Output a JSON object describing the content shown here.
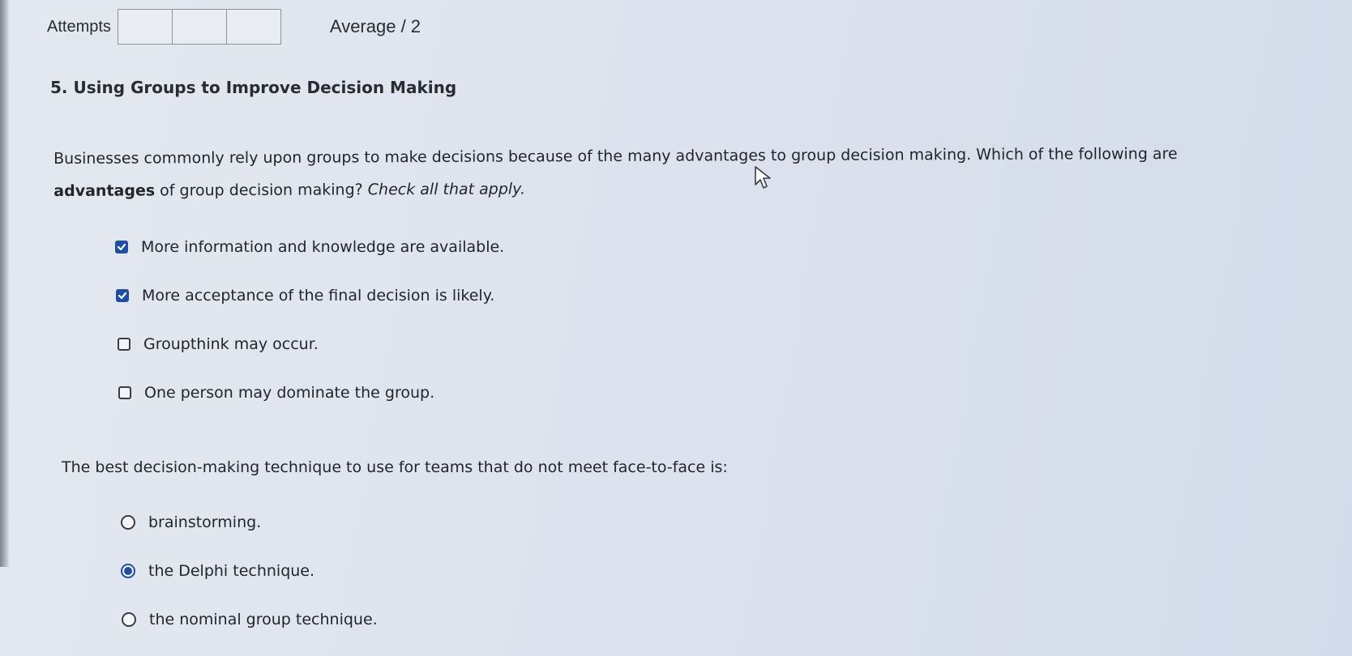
{
  "attempts": {
    "label": "Attempts",
    "boxes": 3,
    "average_label": "Average / 2"
  },
  "question": {
    "title": "5. Using Groups to Improve Decision Making",
    "prompt_part1": "Businesses commonly rely upon groups to make decisions because of the many advantages to group decision making. Which of the following are",
    "prompt_bold": "advantages",
    "prompt_part2": " of group decision making? ",
    "prompt_italic": "Check all that apply."
  },
  "checkbox_options": [
    {
      "label": "More information and knowledge are available.",
      "checked": true
    },
    {
      "label": "More acceptance of the final decision is likely.",
      "checked": true
    },
    {
      "label": "Groupthink may occur.",
      "checked": false
    },
    {
      "label": "One person may dominate the group.",
      "checked": false
    }
  ],
  "question2": {
    "text": "The best decision-making technique to use for teams that do not meet face-to-face is:"
  },
  "radio_options": [
    {
      "label": "brainstorming.",
      "selected": false
    },
    {
      "label": "the Delphi technique.",
      "selected": true
    },
    {
      "label": "the nominal group technique.",
      "selected": false
    }
  ],
  "colors": {
    "accent": "#1e4fa8",
    "text": "#23252b",
    "background": "#dde3ee"
  },
  "icons": {
    "cursor": "mouse-pointer-icon",
    "checkmark": "checkmark-icon"
  }
}
